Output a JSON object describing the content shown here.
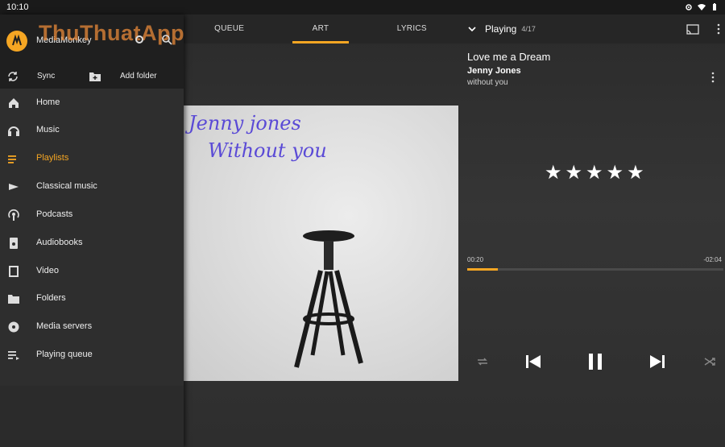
{
  "status_bar": {
    "time": "10:10"
  },
  "watermark": "ThuThuatApp",
  "drawer": {
    "app_name": "MediaMonkey",
    "sync_label": "Sync",
    "add_folder_label": "Add folder",
    "items": [
      {
        "label": "Home",
        "icon": "home-icon",
        "active": false
      },
      {
        "label": "Music",
        "icon": "headphones-icon",
        "active": false
      },
      {
        "label": "Playlists",
        "icon": "playlist-icon",
        "active": true
      },
      {
        "label": "Classical music",
        "icon": "classical-icon",
        "active": false
      },
      {
        "label": "Podcasts",
        "icon": "podcast-icon",
        "active": false
      },
      {
        "label": "Audiobooks",
        "icon": "audiobook-icon",
        "active": false
      },
      {
        "label": "Video",
        "icon": "video-icon",
        "active": false
      },
      {
        "label": "Folders",
        "icon": "folder-icon",
        "active": false
      },
      {
        "label": "Media servers",
        "icon": "media-server-icon",
        "active": false
      },
      {
        "label": "Playing queue",
        "icon": "queue-icon",
        "active": false
      }
    ]
  },
  "tabs": [
    {
      "label": "QUEUE",
      "active": false
    },
    {
      "label": "ART",
      "active": true
    },
    {
      "label": "LYRICS",
      "active": false
    }
  ],
  "album_art": {
    "line1": "Jenny jones",
    "line2": "Without you"
  },
  "now_playing": {
    "header_label": "Playing",
    "count": "4/17",
    "title": "Love me a Dream",
    "artist": "Jenny Jones",
    "album": "without you",
    "rating_stars": 5,
    "time_current": "00:20",
    "time_remaining": "-02:04",
    "progress_fraction": 0.12
  },
  "colors": {
    "accent": "#f5a623",
    "background": "#2e2e2e"
  }
}
